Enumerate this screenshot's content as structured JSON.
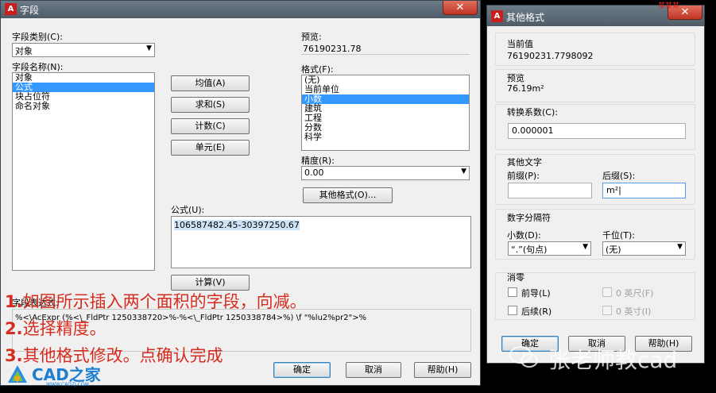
{
  "field_dialog": {
    "title": "字段",
    "close_label": "✕",
    "category_label": "字段类别(C):",
    "category_value": "对象",
    "name_label": "字段名称(N):",
    "names": [
      "对象",
      "公式",
      "块占位符",
      "命名对象"
    ],
    "selected_name_index": 1,
    "buttons": {
      "average": "均值(A)",
      "sum": "求和(S)",
      "count": "计数(C)",
      "cell": "单元(E)",
      "evaluate": "计算(V)",
      "other_format": "其他格式(O)...",
      "ok": "确定",
      "cancel": "取消",
      "help": "帮助(H)"
    },
    "preview_label": "预览:",
    "preview_value": "76190231.78",
    "format_label": "格式(F):",
    "formats": [
      "(无)",
      "当前单位",
      "小数",
      "建筑",
      "工程",
      "分数",
      "科学"
    ],
    "selected_format_index": 2,
    "precision_label": "精度(R):",
    "precision_value": "0.00",
    "formula_label": "公式(U):",
    "formula_value": "106587482.45-30397250.67",
    "expression_label": "字段表达式:",
    "expression_value": "%<\\AcExpr (%<\\_FldPtr 1250338720>%-%<\\_FldPtr 1250338784>%) \\f \"%lu2%pr2\">%"
  },
  "other_dialog": {
    "title": "其他格式",
    "close_label": "✕",
    "current_value_label": "当前值",
    "current_value": "76190231.7798092",
    "preview_label": "预览",
    "preview_value": "76.19m²",
    "conversion_label": "转换系数(C):",
    "conversion_value": "0.000001",
    "other_text_label": "其他文字",
    "prefix_label": "前缀(P):",
    "prefix_value": "",
    "suffix_label": "后缀(S):",
    "suffix_value": "m²|",
    "digit_sep_label": "数字分隔符",
    "decimal_label": "小数(D):",
    "decimal_value": "“.”(句点)",
    "thousands_label": "千位(T):",
    "thousands_value": "(无)",
    "zero_label": "消零",
    "leading_label": "前导(L)",
    "trailing_label": "后续(R)",
    "feet_label": "0 英尺(F)",
    "inches_label": "0 英寸(I)",
    "ok": "确定",
    "cancel": "取消",
    "help": "帮助(H)"
  },
  "annotations": [
    {
      "num": "1.",
      "text": "如图所示插入两个面积的字段，向减。"
    },
    {
      "num": "2.",
      "text": "选择精度。"
    },
    {
      "num": "3.",
      "text": "其他格式修改。点确认完成"
    }
  ],
  "branding": {
    "logo_text": "CAD之家",
    "logo_url": "WWW.CADZJ.COM",
    "watermark": "张老师教cad",
    "corner_text": "某某某"
  },
  "colors": {
    "selection": "#3399ff",
    "annotation": "#d62b1f",
    "titlebar": "#5d6a76",
    "close": "#c03423"
  }
}
